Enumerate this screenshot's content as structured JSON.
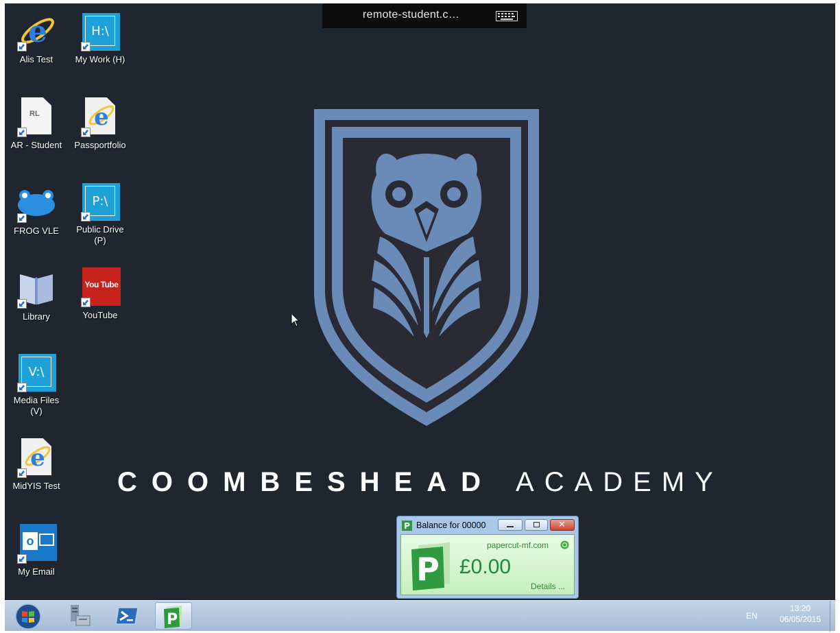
{
  "remote_session": {
    "title": "remote-student.c…",
    "keyboard_icon": "keyboard-icon"
  },
  "desktop_icons": [
    {
      "label": "Alis Test",
      "icon": "internet-explorer-icon"
    },
    {
      "label": "My Work (H)",
      "icon": "network-drive-icon",
      "drive_text": "H:\\"
    },
    {
      "label": "AR - Student",
      "icon": "document-icon",
      "doc_text": "RL"
    },
    {
      "label": "Passportfolio",
      "icon": "internet-explorer-icon"
    },
    {
      "label": "FROG VLE",
      "icon": "frog-icon"
    },
    {
      "label": "Public Drive (P)",
      "icon": "network-drive-icon",
      "drive_text": "P:\\"
    },
    {
      "label": "Library",
      "icon": "library-book-icon"
    },
    {
      "label": "YouTube",
      "icon": "youtube-icon",
      "brand_text": "You Tube"
    },
    {
      "label": "Media Files (V)",
      "icon": "network-drive-icon",
      "drive_text": "V:\\"
    },
    {
      "label": "MidYIS Test",
      "icon": "internet-explorer-icon"
    },
    {
      "label": "My Email",
      "icon": "outlook-icon"
    }
  ],
  "wallpaper": {
    "brand_primary": "COOMBESHEAD",
    "brand_secondary": "ACADEMY",
    "crest_color": "#6a8bb8"
  },
  "papercut_window": {
    "title": "Balance for 00000",
    "site": "papercut-mf.com",
    "balance": "£0.00",
    "details_link": "Details ..."
  },
  "taskbar": {
    "items": [
      "start-orb-icon",
      "server-manager-icon",
      "powershell-icon",
      "papercut-icon"
    ],
    "language": "EN",
    "time": "13:20",
    "date": "06/05/2015"
  },
  "colors": {
    "desktop_bg": "#202630",
    "crest": "#6a8bb8",
    "taskbar": "#b5c7de",
    "papercut_green": "#1f8a3f"
  }
}
